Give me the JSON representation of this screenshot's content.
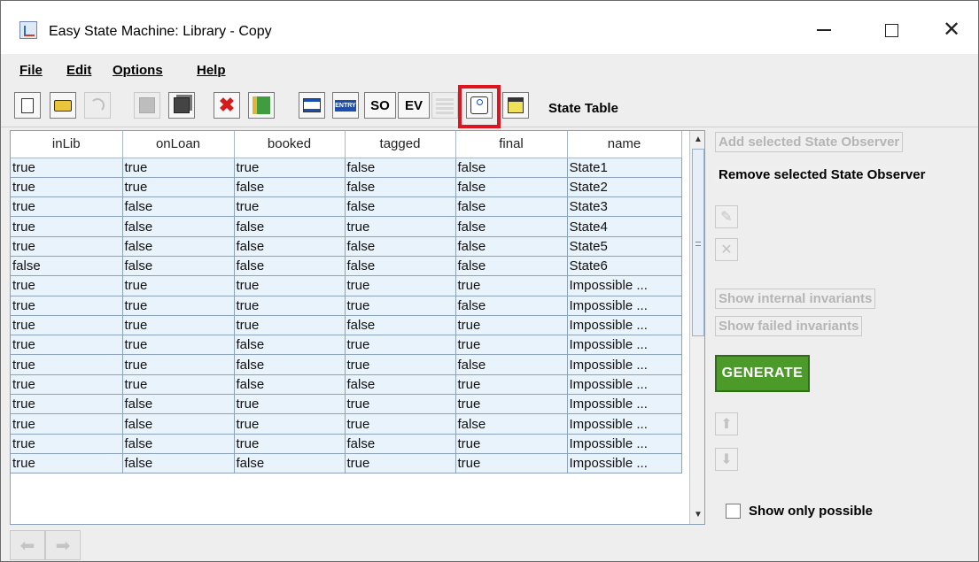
{
  "window": {
    "title": "Easy State Machine: Library - Copy",
    "controls": {
      "minimize": "—",
      "maximize": "☐",
      "close": "✕"
    }
  },
  "menu": [
    "File",
    "Edit",
    "Options",
    "Help"
  ],
  "toolbar": {
    "icons": [
      "new-document",
      "open-folder",
      "undo",
      "save",
      "save-all",
      "delete",
      "library-book",
      "list",
      "entry",
      "so",
      "ev",
      "grid",
      "state-observer-diagram",
      "observer-list"
    ],
    "so_label": "SO",
    "ev_label": "EV",
    "view_label": "State Table",
    "highlighted_icon": "state-observer-diagram",
    "highlight_color": "#e0141e"
  },
  "table": {
    "columns": [
      "inLib",
      "onLoan",
      "booked",
      "tagged",
      "final",
      "name"
    ],
    "rows": [
      [
        "true",
        "true",
        "true",
        "false",
        "false",
        "State1"
      ],
      [
        "true",
        "true",
        "false",
        "false",
        "false",
        "State2"
      ],
      [
        "true",
        "false",
        "true",
        "false",
        "false",
        "State3"
      ],
      [
        "true",
        "false",
        "false",
        "true",
        "false",
        "State4"
      ],
      [
        "true",
        "false",
        "false",
        "false",
        "false",
        "State5"
      ],
      [
        "false",
        "false",
        "false",
        "false",
        "false",
        "State6"
      ],
      [
        "true",
        "true",
        "true",
        "true",
        "true",
        "Impossible ..."
      ],
      [
        "true",
        "true",
        "true",
        "true",
        "false",
        "Impossible ..."
      ],
      [
        "true",
        "true",
        "true",
        "false",
        "true",
        "Impossible ..."
      ],
      [
        "true",
        "true",
        "false",
        "true",
        "true",
        "Impossible ..."
      ],
      [
        "true",
        "true",
        "false",
        "true",
        "false",
        "Impossible ..."
      ],
      [
        "true",
        "true",
        "false",
        "false",
        "true",
        "Impossible ..."
      ],
      [
        "true",
        "false",
        "true",
        "true",
        "true",
        "Impossible ..."
      ],
      [
        "true",
        "false",
        "true",
        "true",
        "false",
        "Impossible ..."
      ],
      [
        "true",
        "false",
        "true",
        "false",
        "true",
        "Impossible ..."
      ],
      [
        "true",
        "false",
        "false",
        "true",
        "true",
        "Impossible ..."
      ]
    ],
    "cell_color": "#e9f3fb"
  },
  "right_panel": {
    "add_observer": "Add selected State Observer",
    "remove_observer": "Remove selected State Observer",
    "edit_icon": "edit-icon",
    "delete_icon": "x-icon",
    "show_internal": "Show internal invariants",
    "show_failed": "Show failed invariants",
    "generate": "GENERATE",
    "generate_color": "#4c9a2a",
    "up_icon": "arrow-up-icon",
    "down_icon": "arrow-down-icon",
    "show_only_possible": "Show only possible",
    "show_only_possible_checked": false
  },
  "bottom_nav": {
    "back_icon": "arrow-left-icon",
    "forward_icon": "arrow-right-icon"
  }
}
